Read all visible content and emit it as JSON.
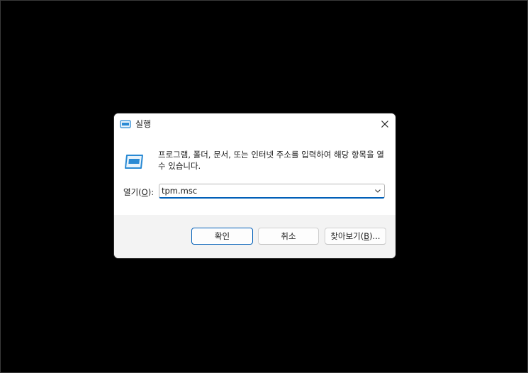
{
  "dialog": {
    "title": "실행",
    "description": "프로그램, 폴더, 문서, 또는 인터넷 주소를 입력하여 해당 항목을 열 수 있습니다.",
    "open_label_prefix": "열기(",
    "open_label_mnemonic": "O",
    "open_label_suffix": "):",
    "open_value": "tpm.msc",
    "buttons": {
      "ok": "확인",
      "cancel": "취소",
      "browse_prefix": "찾아보기(",
      "browse_mnemonic": "B",
      "browse_suffix": ")..."
    }
  },
  "icons": {
    "title": "run-window-icon",
    "content": "run-window-icon",
    "close": "close-icon",
    "dropdown": "chevron-down-icon"
  },
  "colors": {
    "accent": "#005fb8",
    "icon_blue": "#2a8ad4",
    "background": "#000000"
  }
}
